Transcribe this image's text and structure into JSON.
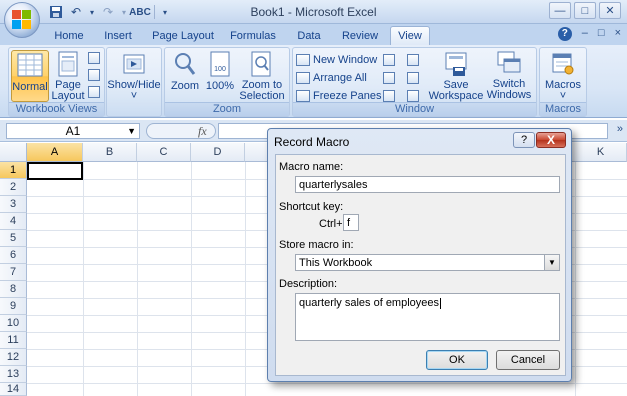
{
  "window": {
    "title": "Book1 - Microsoft Excel",
    "minimize": "—",
    "restore": "□",
    "close": "✕"
  },
  "tabs": [
    {
      "label": "Home"
    },
    {
      "label": "Insert"
    },
    {
      "label": "Page Layout"
    },
    {
      "label": "Formulas"
    },
    {
      "label": "Data"
    },
    {
      "label": "Review"
    },
    {
      "label": "View",
      "active": true
    }
  ],
  "tab_right": {
    "help": "?",
    "min": "–",
    "restore": "□",
    "close": "×"
  },
  "ribbon": {
    "workbook_views": {
      "label": "Workbook Views",
      "normal": "Normal",
      "page_layout_1": "Page",
      "page_layout_2": "Layout"
    },
    "show_hide": {
      "label_1": "Show/Hide",
      "arrow": "˅"
    },
    "zoom": {
      "label": "Zoom",
      "zoom": "Zoom",
      "hundred": "100%",
      "to_selection_1": "Zoom to",
      "to_selection_2": "Selection"
    },
    "window": {
      "label": "Window",
      "new_window": "New Window",
      "arrange_all": "Arrange All",
      "freeze_panes": "Freeze Panes",
      "freeze_arrow": "˅",
      "save_ws_1": "Save",
      "save_ws_2": "Workspace",
      "switch_1": "Switch",
      "switch_2": "Windows",
      "switch_arrow": "˅"
    },
    "macros": {
      "label": "Macros",
      "btn": "Macros",
      "arrow": "˅"
    }
  },
  "formula_bar": {
    "name_box": "A1",
    "fx": "fx",
    "dropdown": "▼"
  },
  "grid": {
    "columns": [
      "A",
      "B",
      "C",
      "D",
      "K"
    ],
    "rows": [
      "1",
      "2",
      "3",
      "4",
      "5",
      "6",
      "7",
      "8",
      "9",
      "10",
      "11",
      "12",
      "13",
      "14"
    ]
  },
  "dialog": {
    "title": "Record Macro",
    "help": "?",
    "close": "X",
    "macro_name_label": "Macro name:",
    "macro_name_value": "quarterlysales",
    "shortcut_label": "Shortcut key:",
    "ctrl_label": "Ctrl+",
    "shortcut_value": "f",
    "store_label": "Store macro in:",
    "store_value": "This Workbook",
    "store_arrow": "▼",
    "description_label": "Description:",
    "description_value": "quarterly sales of employees",
    "ok": "OK",
    "cancel": "Cancel"
  }
}
